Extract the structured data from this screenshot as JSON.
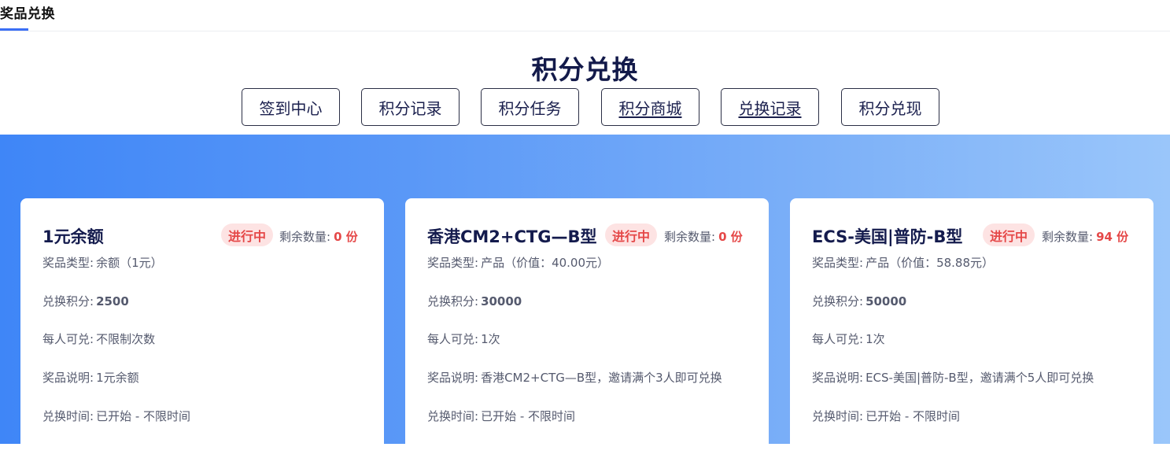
{
  "header": {
    "tab_label": "奖品兑换"
  },
  "page": {
    "title": "积分兑换"
  },
  "nav": {
    "items": [
      {
        "label": "签到中心"
      },
      {
        "label": "积分记录"
      },
      {
        "label": "积分任务"
      },
      {
        "label": "积分商城"
      },
      {
        "label": "兑换记录"
      },
      {
        "label": "积分兑现"
      }
    ]
  },
  "labels": {
    "status": "进行中",
    "remaining": "剩余数量:",
    "type": "奖品类型:",
    "points": "兑换积分:",
    "limit": "每人可兑:",
    "desc": "奖品说明:",
    "time": "兑换时间:"
  },
  "cards": [
    {
      "name": "1元余额",
      "remaining": "0 份",
      "type_value": "余额（1元）",
      "points_value": "2500",
      "limit_value": "不限制次数",
      "desc_value": "1元余额",
      "time_value": "已开始 - 不限时间"
    },
    {
      "name": "香港CM2+CTG—B型",
      "remaining": "0 份",
      "type_value": "产品（价值：40.00元）",
      "points_value": "30000",
      "limit_value": "1次",
      "desc_value": "香港CM2+CTG—B型，邀请满个3人即可兑换",
      "time_value": "已开始 - 不限时间"
    },
    {
      "name": "ECS-美国|普防-B型",
      "remaining": "94 份",
      "type_value": "产品（价值：58.88元）",
      "points_value": "50000",
      "limit_value": "1次",
      "desc_value": "ECS-美国|普防-B型，邀请满个5人即可兑换",
      "time_value": "已开始 - 不限时间"
    }
  ],
  "colors": {
    "accent": "#3b6ff5",
    "status_bg": "#fde3e3",
    "status_text": "#e54848",
    "band_start": "#3f86f7",
    "band_end": "#9ac6fa"
  }
}
